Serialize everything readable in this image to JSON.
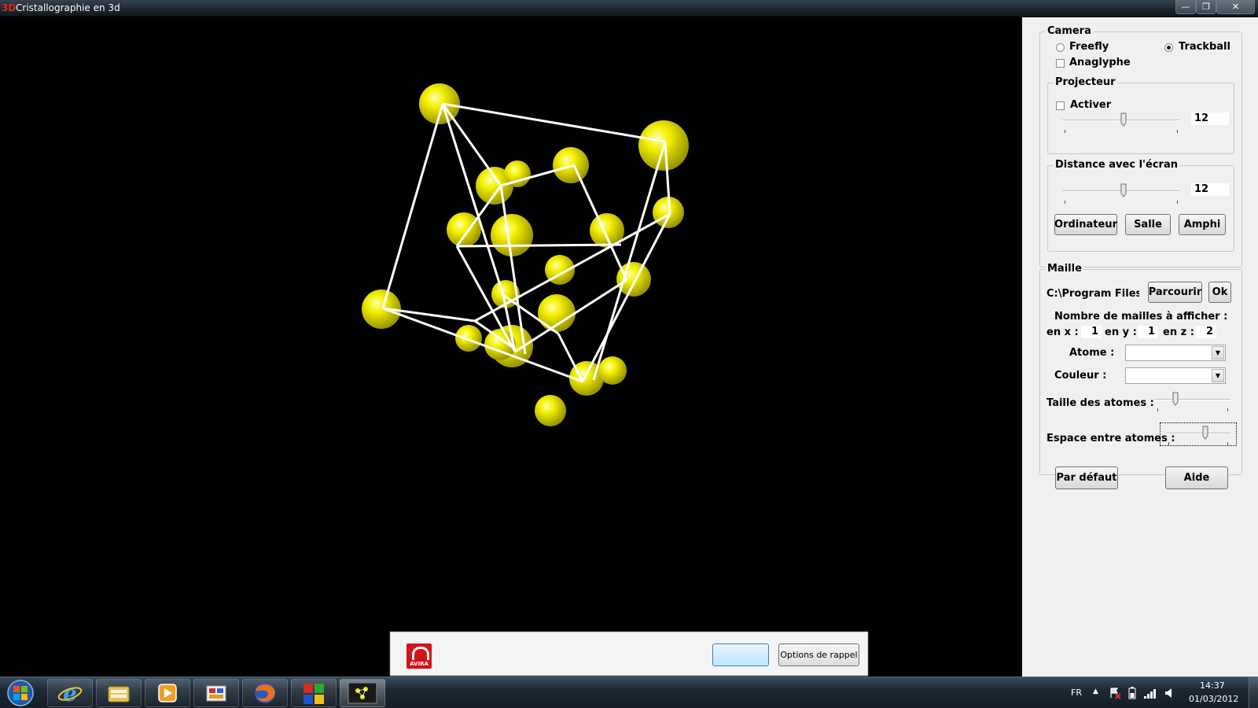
{
  "window": {
    "app_icon_text": "3D",
    "title": "Cristallographie en 3d"
  },
  "camera": {
    "legend": "Camera",
    "freefly_label": "Freefly",
    "trackball_label": "Trackball",
    "selected_mode": "Trackball",
    "anaglyphe_label": "Anaglyphe",
    "anaglyphe_checked": false
  },
  "projecteur": {
    "legend": "Projecteur",
    "activer_label": "Activer",
    "activer_checked": false,
    "value": "12"
  },
  "distance": {
    "legend": "Distance avec l'écran",
    "value": "12",
    "buttons": [
      "Ordinateur",
      "Salle",
      "Amphi"
    ]
  },
  "maille": {
    "legend": "Maille",
    "path_value": "C:\\Program Files (x",
    "browse_label": "Parcourir",
    "ok_label": "Ok",
    "count_label": "Nombre de mailles à afficher :",
    "en_x_label": "en x :",
    "en_x_value": "1",
    "en_y_label": "en y :",
    "en_y_value": "1",
    "en_z_label": "en z :",
    "en_z_value": "2",
    "atome_label": "Atome :",
    "atome_value": "",
    "couleur_label": "Couleur :",
    "couleur_value": "",
    "taille_label": "Taille des atomes :",
    "espace_label": "Espace entre atomes :"
  },
  "bottom_buttons": {
    "default_label": "Par défaut",
    "help_label": "Aide"
  },
  "popup": {
    "logo_text": "AVIRA",
    "blue_button_label": "",
    "reminder_button_label": "Options de rappel"
  },
  "taskbar": {
    "language": "FR",
    "time": "14:37",
    "date": "01/03/2012"
  },
  "colors": {
    "atom": "#f2ef00",
    "bond": "#ffffff",
    "background": "#000000",
    "panel": "#f0f0f0"
  }
}
